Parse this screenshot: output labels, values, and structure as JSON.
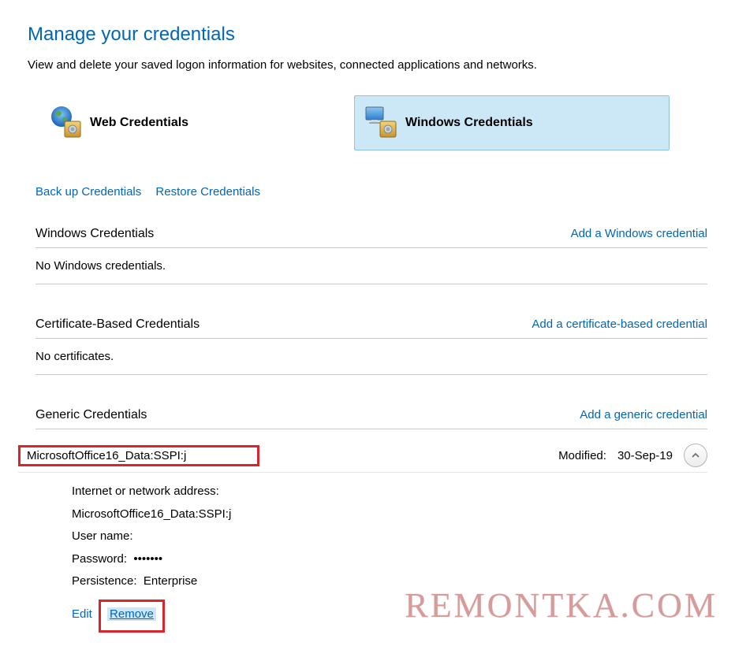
{
  "heading": "Manage your credentials",
  "subtitle": "View and delete your saved logon information for websites, connected applications and networks.",
  "tabs": {
    "web": "Web Credentials",
    "windows": "Windows Credentials"
  },
  "actions": {
    "backup": "Back up Credentials",
    "restore": "Restore Credentials"
  },
  "sections": {
    "windows": {
      "title": "Windows Credentials",
      "add": "Add a Windows credential",
      "empty": "No Windows credentials."
    },
    "cert": {
      "title": "Certificate-Based Credentials",
      "add": "Add a certificate-based credential",
      "empty": "No certificates."
    },
    "generic": {
      "title": "Generic Credentials",
      "add": "Add a generic credential"
    }
  },
  "entry": {
    "name": "MicrosoftOffice16_Data:SSPI:j",
    "modified_label": "Modified:",
    "modified_value": "30-Sep-19",
    "address_label": "Internet or network address:",
    "address_value": "MicrosoftOffice16_Data:SSPI:j",
    "username_label": "User name:",
    "username_value": "",
    "password_label": "Password:",
    "password_value": "•••••••",
    "persistence_label": "Persistence:",
    "persistence_value": "Enterprise",
    "edit": "Edit",
    "remove": "Remove"
  },
  "watermark": "REMONTKA.COM"
}
